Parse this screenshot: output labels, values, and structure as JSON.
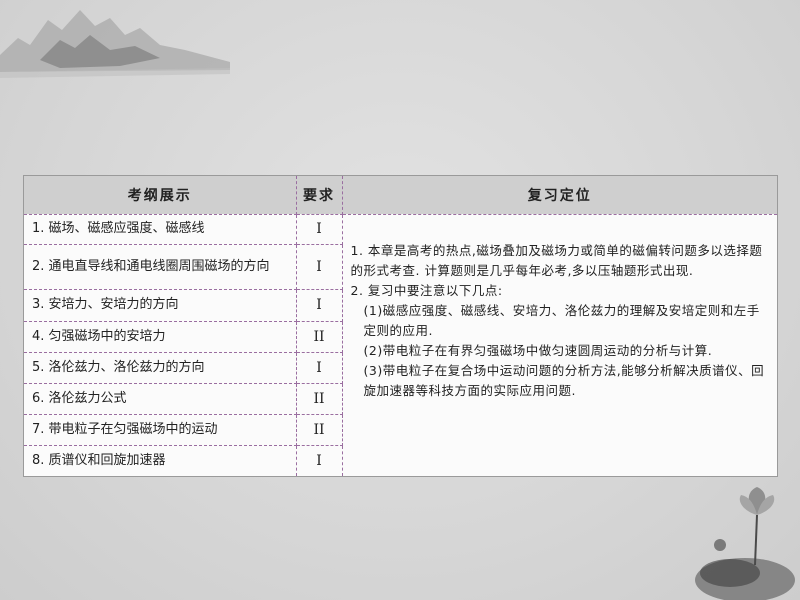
{
  "table": {
    "headers": [
      "考纲展示",
      "要求",
      "复习定位"
    ],
    "rows": [
      {
        "topic": "1. 磁场、磁感应强度、磁感线",
        "level": "I"
      },
      {
        "topic": "2. 通电直导线和通电线圈周围磁场的方向",
        "level": "I"
      },
      {
        "topic": "3. 安培力、安培力的方向",
        "level": "I"
      },
      {
        "topic": "4. 匀强磁场中的安培力",
        "level": "II"
      },
      {
        "topic": "5. 洛伦兹力、洛伦兹力的方向",
        "level": "I"
      },
      {
        "topic": "6. 洛伦兹力公式",
        "level": "II"
      },
      {
        "topic": "7. 带电粒子在匀强磁场中的运动",
        "level": "II"
      },
      {
        "topic": "8. 质谱仪和回旋加速器",
        "level": "I"
      }
    ],
    "review": {
      "p1": "1. 本章是高考的热点,磁场叠加及磁场力或简单的磁偏转问题多以选择题的形式考查. 计算题则是几乎每年必考,多以压轴题形式出现.",
      "p2": "2. 复习中要注意以下几点:",
      "p3": "(1)磁感应强度、磁感线、安培力、洛伦兹力的理解及安培定则和左手定则的应用.",
      "p4": "(2)带电粒子在有界匀强磁场中做匀速圆周运动的分析与计算.",
      "p5": "(3)带电粒子在复合场中运动问题的分析方法,能够分析解决质谱仪、回旋加速器等科技方面的实际应用问题."
    }
  }
}
